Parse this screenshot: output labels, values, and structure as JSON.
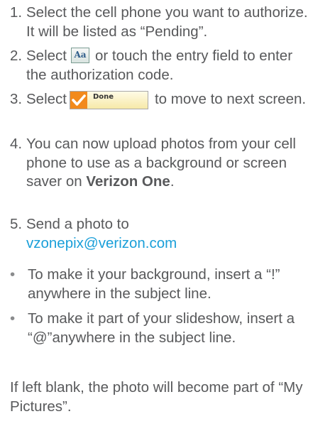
{
  "steps": [
    {
      "num": "1.",
      "text": "Select the cell phone you want to authorize. It will be listed as “Pending”."
    },
    {
      "num": "2.",
      "pre": "Select",
      "icon": "aa-keyboard-icon",
      "icon_text": "Aa",
      "post": "or touch the entry field to enter the authorization code."
    },
    {
      "num": "3.",
      "pre": "Select",
      "button_label": "Done",
      "post": "to move to next screen."
    },
    {
      "num": "4.",
      "text": "You can now upload photos from your cell phone to use as a background or screen saver on ",
      "bold": "Verizon One",
      "after": "."
    },
    {
      "num": "5.",
      "text": "Send a photo to",
      "email": "vzonepix@verizon.com"
    }
  ],
  "bullets": [
    {
      "mark": "•",
      "text": "To make it your background, insert a “!” anywhere in the subject line."
    },
    {
      "mark": "•",
      "text": "To make it part of your slideshow, insert a “@”anywhere in the subject line."
    }
  ],
  "footer": "If left blank, the photo will become part of “My Pictures”.",
  "colors": {
    "text": "#58595b",
    "link": "#1a9fd9",
    "done_check": "#f28a1c"
  }
}
